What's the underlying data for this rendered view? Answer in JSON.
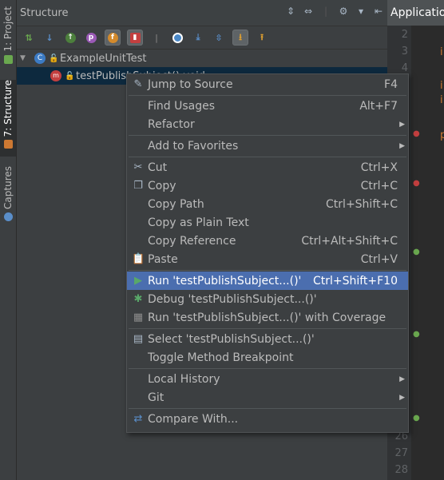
{
  "left_strip": {
    "tabs": [
      {
        "label": "1: Project",
        "active": false
      },
      {
        "label": "7: Structure",
        "active": true
      },
      {
        "label": "Captures",
        "active": false
      }
    ]
  },
  "structure": {
    "title": "Structure",
    "tree": {
      "class_node": {
        "icon": "class-icon",
        "label": "ExampleUnitTest"
      },
      "method_node": {
        "icon": "method-icon",
        "label": "testPublishSubject():void"
      }
    }
  },
  "editor": {
    "tab_title": "Applicatio",
    "line_numbers": [
      "2",
      "3",
      "4",
      "26",
      "27",
      "28"
    ],
    "code_fragments": [
      "i",
      "i",
      "i",
      "p"
    ]
  },
  "context_menu": {
    "items": [
      {
        "label": "Jump to Source",
        "shortcut": "F4",
        "icon": "jump-to-source-icon"
      },
      {
        "label": "Find Usages",
        "shortcut": "Alt+F7"
      },
      {
        "label": "Refactor",
        "submenu": true
      },
      {
        "label": "Add to Favorites",
        "submenu": true
      },
      {
        "label": "Cut",
        "shortcut": "Ctrl+X",
        "icon": "scissors-icon"
      },
      {
        "label": "Copy",
        "shortcut": "Ctrl+C",
        "icon": "copy-icon"
      },
      {
        "label": "Copy Path",
        "shortcut": "Ctrl+Shift+C"
      },
      {
        "label": "Copy as Plain Text"
      },
      {
        "label": "Copy Reference",
        "shortcut": "Ctrl+Alt+Shift+C"
      },
      {
        "label": "Paste",
        "shortcut": "Ctrl+V",
        "icon": "paste-icon"
      },
      {
        "label": "Run 'testPublishSubject...()'",
        "shortcut": "Ctrl+Shift+F10",
        "icon": "run-icon",
        "highlighted": true
      },
      {
        "label": "Debug 'testPublishSubject...()'",
        "icon": "debug-icon"
      },
      {
        "label": "Run 'testPublishSubject...()' with Coverage",
        "icon": "coverage-icon"
      },
      {
        "label": "Select 'testPublishSubject...()'",
        "icon": "select-icon"
      },
      {
        "label": "Toggle Method Breakpoint"
      },
      {
        "label": "Local History",
        "submenu": true
      },
      {
        "label": "Git",
        "submenu": true
      },
      {
        "label": "Compare With...",
        "icon": "compare-icon"
      }
    ]
  },
  "colors": {
    "highlight": "#4b6eaf",
    "background": "#3c3f41",
    "editor_bg": "#2b2b2b"
  }
}
